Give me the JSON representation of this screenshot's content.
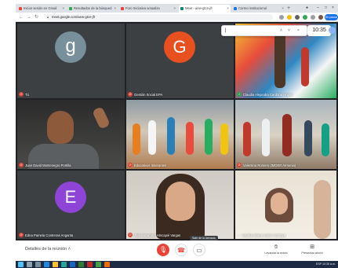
{
  "browser": {
    "tabs": [
      {
        "label": "Iniciar sesión en Gmail",
        "favicon_color": "#ea4335"
      },
      {
        "label": "Resultados de la búsqued",
        "favicon_color": "#34a853"
      },
      {
        "label": "Foro Iniciativa actualiza",
        "favicon_color": "#ea4335"
      },
      {
        "label": "Meet - aew-gtcn-jfr",
        "favicon_color": "#00897b"
      },
      {
        "label": "Correo institucional",
        "favicon_color": "#1a73e8"
      }
    ],
    "new_tab_label": "+",
    "url": "meet.google.com/aew-gtcn-jfr",
    "pause_label": "En pausa"
  },
  "popup": {
    "cursor_text": "|",
    "clock": "10:35"
  },
  "participants": [
    {
      "name": "Tú",
      "avatar_letter": "g",
      "avatar_color": "#78909c",
      "muted": true
    },
    {
      "name": "Gestión Social EPA",
      "avatar_letter": "G",
      "avatar_color": "#e8501f",
      "muted": true
    },
    {
      "name": "Claudia Alejandra Cardona Hoyos",
      "muted": false
    },
    {
      "name": "Juan David Montenegro Portilla",
      "muted": true
    },
    {
      "name": "Educativos Itinerantes",
      "muted": true
    },
    {
      "name": "Valentina Romero (IMDER Armenia)",
      "muted": true
    },
    {
      "name": "Edna Pamela Contreras Angarita",
      "avatar_letter": "E",
      "avatar_color": "#8e44d6",
      "muted": true
    },
    {
      "name": "Jiraí Alexandra Hincapié Vargas",
      "muted": true
    },
    {
      "name": "claudia milena marín montoya",
      "muted": false
    }
  ],
  "controls": {
    "details_label": "Detalles de la reunión",
    "tooltip": "Salir de la llamada",
    "raise_hand_label": "Levantar la mano",
    "present_label": "Presentar ahora"
  },
  "taskbar": {
    "tray_text": "ESP 10:35 a.m."
  }
}
